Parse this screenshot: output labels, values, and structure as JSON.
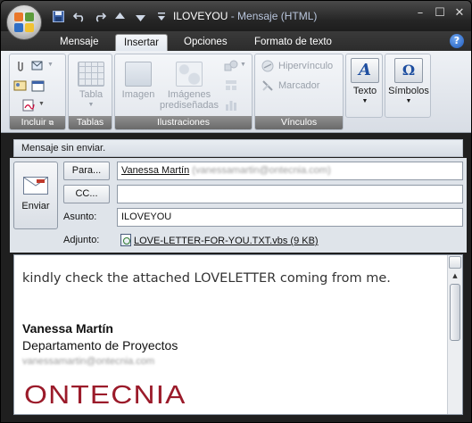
{
  "window": {
    "title_subject": "ILOVEYOU",
    "title_app": " - Mensaje (HTML)",
    "minimize": "–",
    "maximize": "☐",
    "close": "✕"
  },
  "quick_access": [
    "save-icon",
    "undo-icon",
    "redo-icon",
    "up-arrow-icon",
    "down-arrow-icon",
    "customize-icon"
  ],
  "tabs": [
    {
      "label": "Mensaje",
      "active": false
    },
    {
      "label": "Insertar",
      "active": true
    },
    {
      "label": "Opciones",
      "active": false
    },
    {
      "label": "Formato de texto",
      "active": false
    }
  ],
  "help": "?",
  "ribbon": {
    "groups": {
      "incluir": "Incluir",
      "tablas": "Tablas",
      "ilustraciones": "Ilustraciones",
      "vinculos": "Vínculos"
    },
    "tabla": "Tabla",
    "imagen": "Imagen",
    "imagenes_line1": "Imágenes",
    "imagenes_line2": "prediseñadas",
    "hipervinculo": "Hipervínculo",
    "marcador": "Marcador",
    "texto": "Texto",
    "simbolos": "Símbolos"
  },
  "infobar": "Mensaje sin enviar.",
  "send_label": "Enviar",
  "to_button": "Para...",
  "cc_button": "CC...",
  "subject_label": "Asunto:",
  "attachment_label": "Adjunto:",
  "to_name": "Vanessa Martín",
  "to_email_blurred": "(vanessamartin@ontecnia.com)",
  "cc_value": "",
  "subject_value": "ILOVEYOU",
  "attachment": "LOVE-LETTER-FOR-YOU.TXT.vbs (9 KB)",
  "body": {
    "text": "kindly check the attached LOVELETTER coming from me.",
    "sig_name": "Vanessa Martín",
    "sig_dept": "Departamento de Proyectos",
    "sig_email_blurred": "vanessamartin@ontecnia.com",
    "logo": "ONTECNIA"
  },
  "colors": {
    "logo": "#9b1b2a",
    "titlebar": "#262626",
    "ribbon": "#e2e6ec"
  }
}
